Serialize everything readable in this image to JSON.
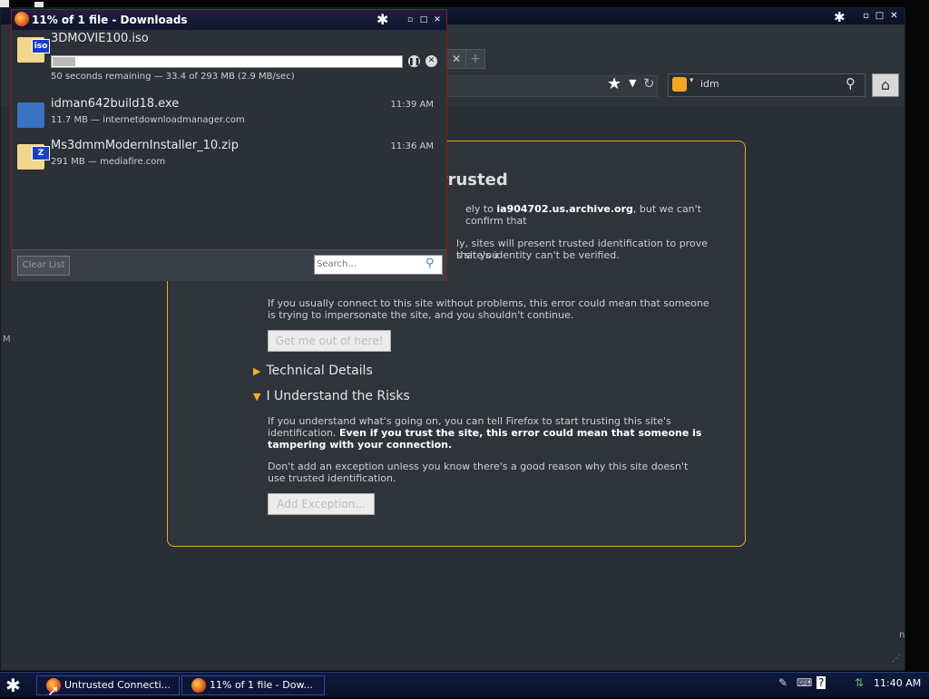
{
  "downloads": {
    "title": "11% of 1 file - Downloads",
    "items": [
      {
        "filename": "3DMOVIE100.iso",
        "badge": "iso",
        "status": "50 seconds remaining — 33.4 of 293 MB (2.9 MB/sec)",
        "progress_fraction": 0.11
      },
      {
        "filename": "idman642build18.exe",
        "status": "11.7 MB — internetdownloadmanager.com",
        "time": "11:39 AM"
      },
      {
        "filename": "Ms3dmmModernInstaller_10.zip",
        "badge": "Z",
        "status": "291 MB — mediafire.com",
        "time": "11:36 AM"
      }
    ],
    "clear_list_label": "Clear List",
    "search_placeholder": "Search..."
  },
  "browser": {
    "search_term": "idm",
    "error_page": {
      "title_fragment": "trusted",
      "p1_prefix": "ely to ",
      "p1_host": "ia904702.us.archive.org",
      "p1_suffix": ", but we can't confirm that",
      "p2": "ly, sites will present trusted identification to prove that you",
      "p3": "s site's identity can't be verified.",
      "p4": "If you usually connect to this site without problems, this error could mean that someone is trying to impersonate the site, and you shouldn't continue.",
      "get_me_out_label": "Get me out of here!",
      "technical_details_label": "Technical Details",
      "understand_risks_label": "I Understand the Risks",
      "p5_normal": "If you understand what's going on, you can tell Firefox to start trusting this site's identification. ",
      "p5_bold": "Even if you trust the site, this error could mean that someone is tampering with your connection.",
      "p6": "Don't add an exception unless you know there's a good reason why this site doesn't use trusted identification.",
      "add_exception_label": "Add Exception..."
    }
  },
  "taskbar": {
    "tasks": [
      {
        "label": "Untrusted Connecti..."
      },
      {
        "label": "11% of 1 file - Dow..."
      }
    ],
    "clock": "11:40 AM"
  },
  "colors": {
    "accent": "#e7a92a",
    "taskbar": "#0f1a3c",
    "window_bg": "#2a2e35"
  }
}
